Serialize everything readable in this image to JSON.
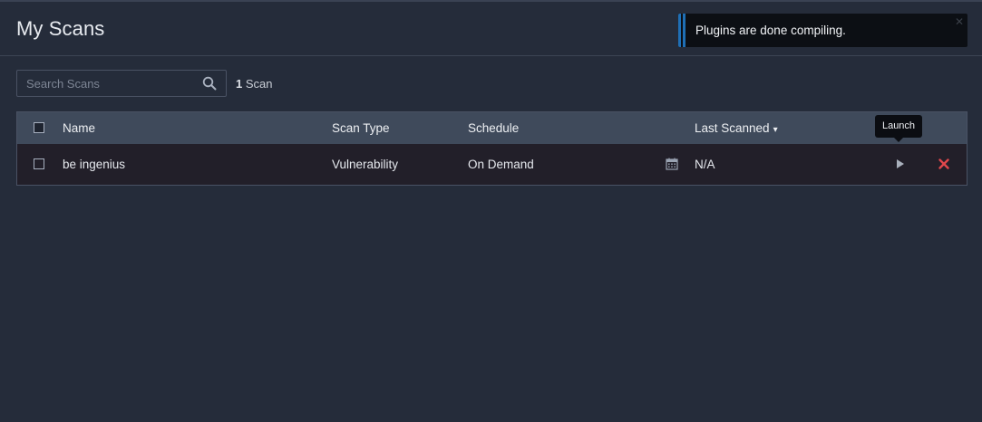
{
  "header": {
    "title": "My Scans"
  },
  "toast": {
    "message": "Plugins are done compiling.",
    "close_icon": "close-icon",
    "accent_color": "#1f6fb5"
  },
  "search": {
    "placeholder": "Search Scans",
    "value": "",
    "icon": "search-icon"
  },
  "scan_count": {
    "number": "1",
    "label": "Scan"
  },
  "table": {
    "columns": {
      "name": "Name",
      "scan_type": "Scan Type",
      "schedule": "Schedule",
      "last_scanned": "Last Scanned",
      "sort_indicator": "▾"
    },
    "rows": [
      {
        "name": "be ingenius",
        "scan_type": "Vulnerability",
        "schedule": "On Demand",
        "schedule_icon": "calendar-icon",
        "last_scanned": "N/A",
        "launch_icon": "play-icon",
        "delete_icon": "close-icon"
      }
    ]
  },
  "tooltip": {
    "text": "Launch"
  },
  "colors": {
    "background": "#252c3a",
    "header_row": "#3f4a5b",
    "data_row": "#221f29",
    "delete": "#e0474c"
  }
}
